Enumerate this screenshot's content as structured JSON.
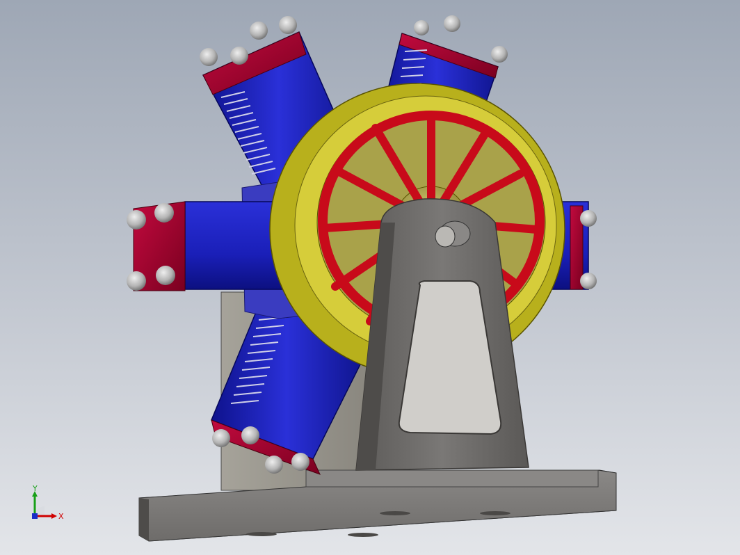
{
  "view": {
    "background_top": "#9ea7b5",
    "background_bottom": "#e3e5e9"
  },
  "model": {
    "cylinder_color": "#1a1fb8",
    "cylinder_head_color": "#a3002c",
    "flywheel_rim_color": "#b8b01c",
    "flywheel_spoke_color": "#c80a1a",
    "stand_color": "#6a6866",
    "base_color": "#7a7876",
    "nut_color": "#b4b4b4"
  },
  "triad": {
    "x_label": "X",
    "y_label": "Y",
    "x_color": "#d00000",
    "y_color": "#18a018",
    "z_color": "#1a2cc8"
  }
}
